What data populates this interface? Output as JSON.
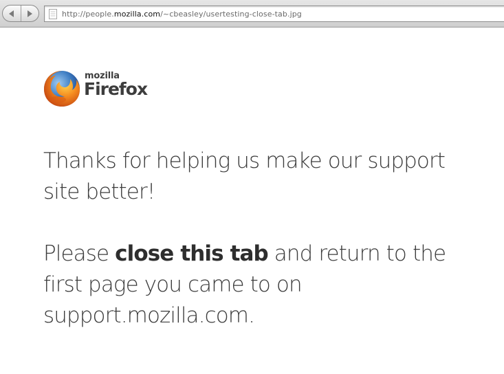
{
  "browser": {
    "url_prefix": "http://people.",
    "url_host": "mozilla.com",
    "url_suffix": "/~cbeasley/usertesting-close-tab.jpg",
    "icons": {
      "back": "back-arrow-icon",
      "forward": "forward-arrow-icon",
      "favicon": "document-icon"
    }
  },
  "logo": {
    "brand_small": "mozilla",
    "brand_large": "Firefox"
  },
  "message": {
    "line1": "Thanks for helping us make our support site better!",
    "line2_before": "Please ",
    "line2_bold": "close this tab",
    "line2_after": " and return to the first page you came to on support.mozilla.com."
  },
  "colors": {
    "text": "#3b3b3b",
    "background": "#ffffff"
  }
}
